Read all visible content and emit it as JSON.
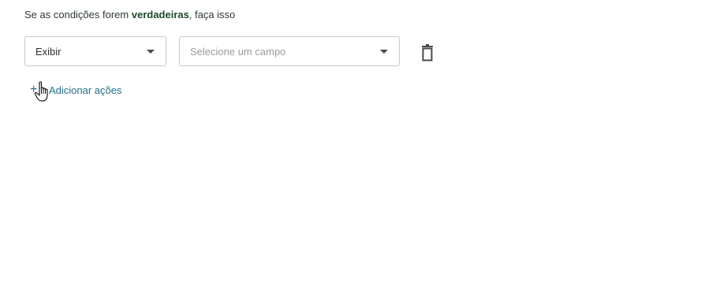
{
  "heading": {
    "prefix": "Se as condições forem",
    "emphasis": "verdadeiras",
    "suffix": ", faça isso"
  },
  "action_select": {
    "value": "Exibir"
  },
  "field_select": {
    "placeholder": "Selecione um campo"
  },
  "add_actions": {
    "plus": "+",
    "label": "Adicionar ações"
  },
  "icons": {
    "delete": "trash-icon",
    "dropdown": "chevron-down-icon",
    "cursor": "hand-pointer-cursor"
  },
  "colors": {
    "text": "#2d3a33",
    "emphasis": "#1f4a2c",
    "link": "#1f6f8b",
    "border": "#c9c9c9",
    "placeholder": "#9a9a9a"
  }
}
